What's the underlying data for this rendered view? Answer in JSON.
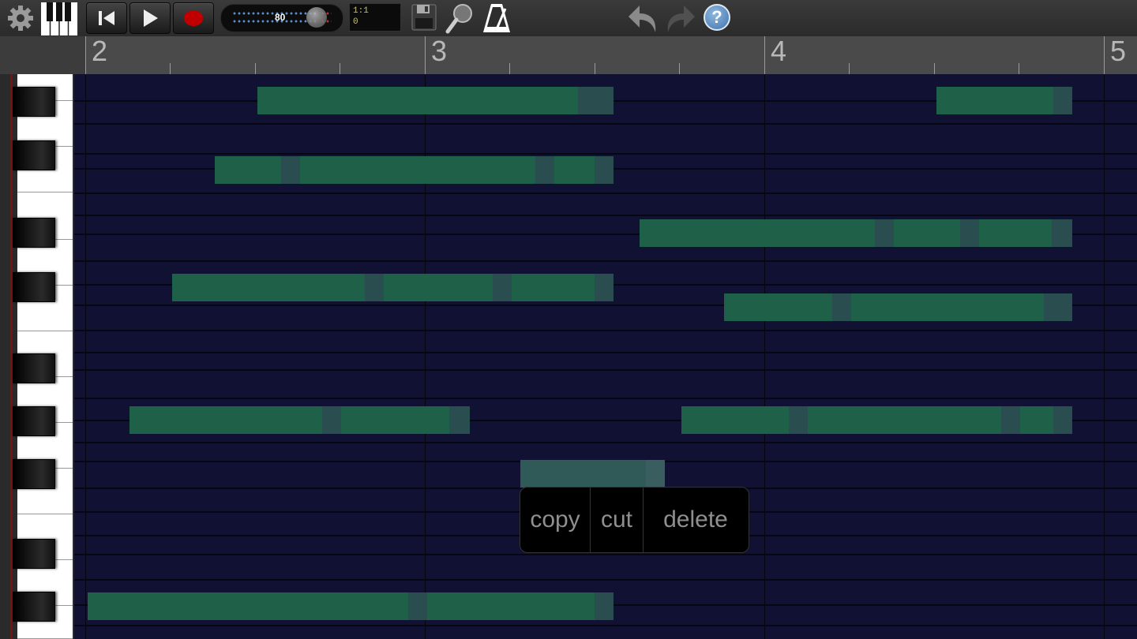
{
  "toolbar": {
    "icons": [
      "gear-icon",
      "piano-keys-icon",
      "skip-to-start-icon",
      "play-icon",
      "record-icon",
      "save-icon",
      "zoom-icon",
      "metronome-icon",
      "undo-icon",
      "redo-icon",
      "help-icon"
    ],
    "tempo_value": "80",
    "position_bar_beat": "1:1",
    "position_tick": "0",
    "help_label": "?"
  },
  "ruler": {
    "bar_labels": [
      "2",
      "3",
      "4",
      "5"
    ]
  },
  "context_menu": {
    "copy_label": "copy",
    "cut_label": "cut",
    "delete_label": "delete"
  },
  "colors": {
    "background": "#111133",
    "note": "#1e6048",
    "note_velocity_segment": "#2a4e50",
    "record": "#c00000"
  }
}
